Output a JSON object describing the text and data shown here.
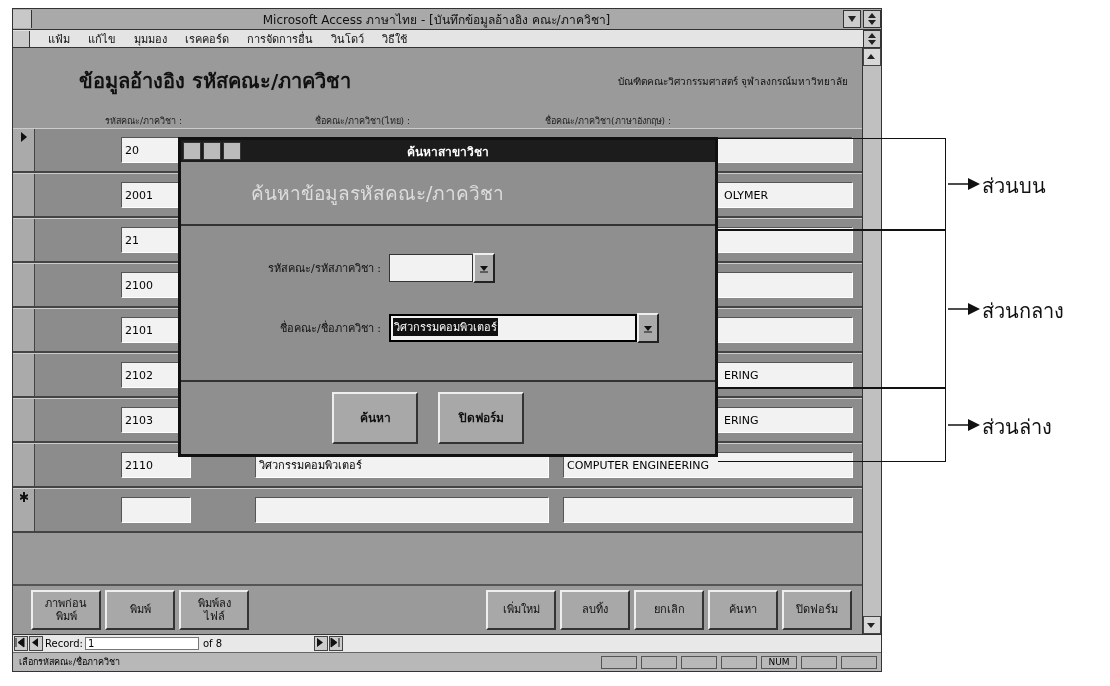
{
  "window": {
    "title": "Microsoft Access ภาษาไทย - [บันทึกข้อมูลอ้างอิง คณะ/ภาควิชา]"
  },
  "menu": [
    "แฟ้ม",
    "แก้ไข",
    "มุมมอง",
    "เรคคอร์ด",
    "การจัดการอื่น",
    "วินโดว์",
    "วิธีใช้"
  ],
  "form": {
    "title": "ข้อมูลอ้างอิง รหัสคณะ/ภาควิชา",
    "subtitle": "บัณฑิตคณะวิศวกรรมศาสตร์ จุฬาลงกรณ์มหาวิทยาลัย",
    "columns": [
      "รหัสคณะ/ภาควิชา :",
      "ชื่อคณะ/ภาควิชา(ไทย) :",
      "ชื่อคณะ/ภาควิชา(ภาษาอังกฤษ) :"
    ],
    "rows": [
      {
        "kind": "current",
        "code": "20"
      },
      {
        "kind": "record",
        "code": "2001",
        "name_english": "OLYMER"
      },
      {
        "kind": "record",
        "code": "21"
      },
      {
        "kind": "record",
        "code": "2100"
      },
      {
        "kind": "record",
        "code": "2101"
      },
      {
        "kind": "record",
        "code": "2102",
        "name_english": "ERING"
      },
      {
        "kind": "record",
        "code": "2103",
        "name_english": "ERING"
      },
      {
        "kind": "record",
        "code": "2110",
        "name_thai": "วิศวกรรมคอมพิวเตอร์",
        "name_english": "COMPUTER ENGINEERING"
      },
      {
        "kind": "new"
      }
    ],
    "buttons_left": [
      "ภาพก่อน\nพิมพ์",
      "พิมพ์",
      "พิมพ์ลง\nไฟล์"
    ],
    "buttons_right": [
      "เพิ่มใหม่",
      "ลบทิ้ง",
      "ยกเลิก",
      "ค้นหา",
      "ปิดฟอร์ม"
    ]
  },
  "navigation": {
    "label": "Record:",
    "current": "1",
    "total": "of 8"
  },
  "status_bar": {
    "message": "เลือกรหัสคณะ/ชื่อภาควิชา",
    "indicator": "NUM"
  },
  "dialog": {
    "title": "ค้นหาสาขาวิชา",
    "heading": "ค้นหาข้อมูลรหัสคณะ/ภาควิชา",
    "fields": [
      {
        "label": "รหัสคณะ/รหัสภาควิชา :"
      },
      {
        "label": "ชื่อคณะ/ชื่อภาควิชา :",
        "value": "วิศวกรรมคอมพิวเตอร์",
        "highlighted": true
      }
    ],
    "buttons": [
      "ค้นหา",
      "ปิดฟอร์ม"
    ]
  },
  "annotations": [
    {
      "label": "ส่วนบน"
    },
    {
      "label": "ส่วนกลาง"
    },
    {
      "label": "ส่วนล่าง"
    }
  ]
}
